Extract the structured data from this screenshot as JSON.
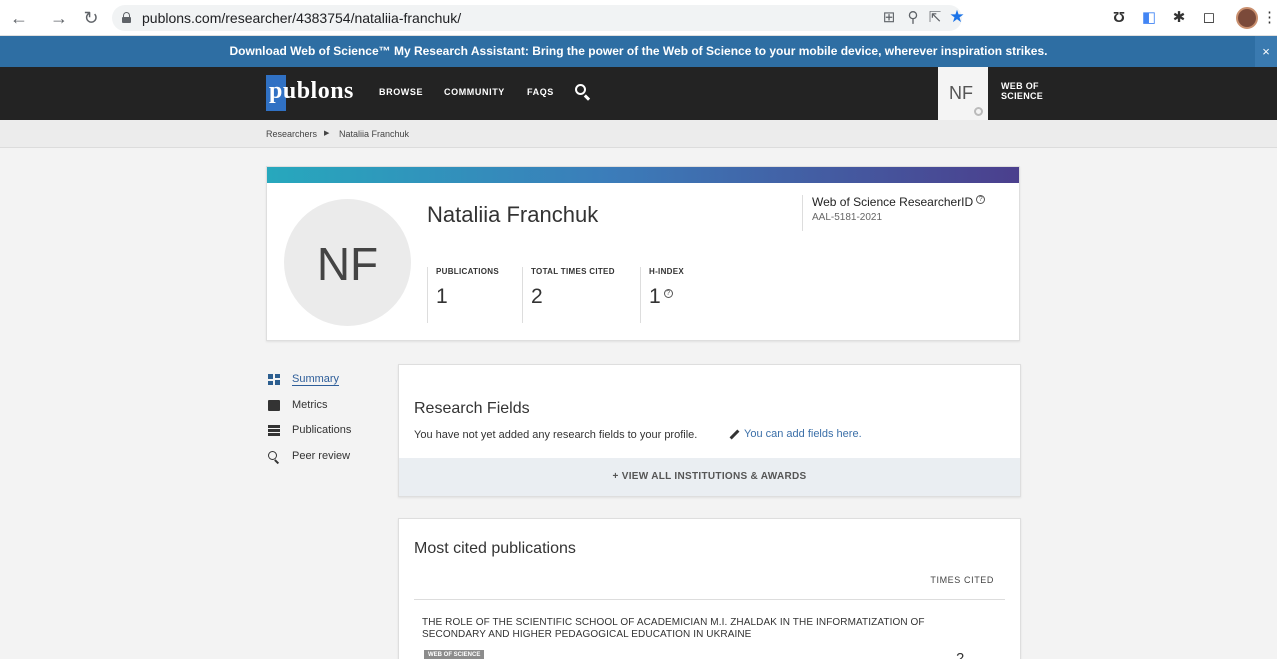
{
  "browser": {
    "url": "publons.com/researcher/4383754/nataliia-franchuk/",
    "icons": [
      "back-icon",
      "forward-icon",
      "reload-icon",
      "lock-icon",
      "translate-icon",
      "zoom-icon",
      "share-icon",
      "star-icon",
      "extension-icon",
      "translate-ext-icon",
      "puzzle-icon",
      "sidepanel-icon",
      "profile-avatar",
      "more-icon"
    ]
  },
  "banner": {
    "text": "Download Web of Science™ My Research Assistant: Bring the power of the Web of Science to your mobile device, wherever inspiration strikes.",
    "close": "×"
  },
  "nav": {
    "logo": "publons",
    "links": [
      "BROWSE",
      "COMMUNITY",
      "FAQS"
    ],
    "user_initials": "NF",
    "wos_label_line1": "WEB OF",
    "wos_label_line2": "SCIENCE"
  },
  "breadcrumb": {
    "root": "Researchers",
    "current": "Nataliia Franchuk"
  },
  "profile": {
    "initials": "NF",
    "name": "Nataliia Franchuk",
    "metrics": [
      {
        "label": "PUBLICATIONS",
        "value": "1"
      },
      {
        "label": "TOTAL TIMES CITED",
        "value": "2"
      },
      {
        "label": "H-INDEX",
        "value": "1"
      }
    ],
    "researcher_id_label": "Web of Science ResearcherID",
    "researcher_id": "AAL-5181-2021",
    "colors": {
      "gradient_start": "#27a8bd",
      "gradient_end": "#4b3f8d"
    }
  },
  "sidebar": {
    "items": [
      {
        "label": "Summary",
        "icon": "summary-icon",
        "active": true
      },
      {
        "label": "Metrics",
        "icon": "metrics-icon",
        "active": false
      },
      {
        "label": "Publications",
        "icon": "publications-icon",
        "active": false
      },
      {
        "label": "Peer review",
        "icon": "peer-review-icon",
        "active": false
      }
    ]
  },
  "research_fields": {
    "heading": "Research Fields",
    "text": "You have not yet added any research fields to your profile.",
    "add_link": "You can add fields here.",
    "view_all": "+ VIEW ALL INSTITUTIONS & AWARDS"
  },
  "most_cited": {
    "heading": "Most cited publications",
    "column_header": "TIMES CITED",
    "publications": [
      {
        "title": "THE ROLE OF THE SCIENTIFIC SCHOOL OF ACADEMICIAN M.I. ZHALDAK IN THE INFORMATIZATION OF SECONDARY AND HIGHER PEDAGOGICAL EDUCATION IN UKRAINE",
        "badge": "WEB OF SCIENCE",
        "times_cited": "2"
      }
    ]
  }
}
